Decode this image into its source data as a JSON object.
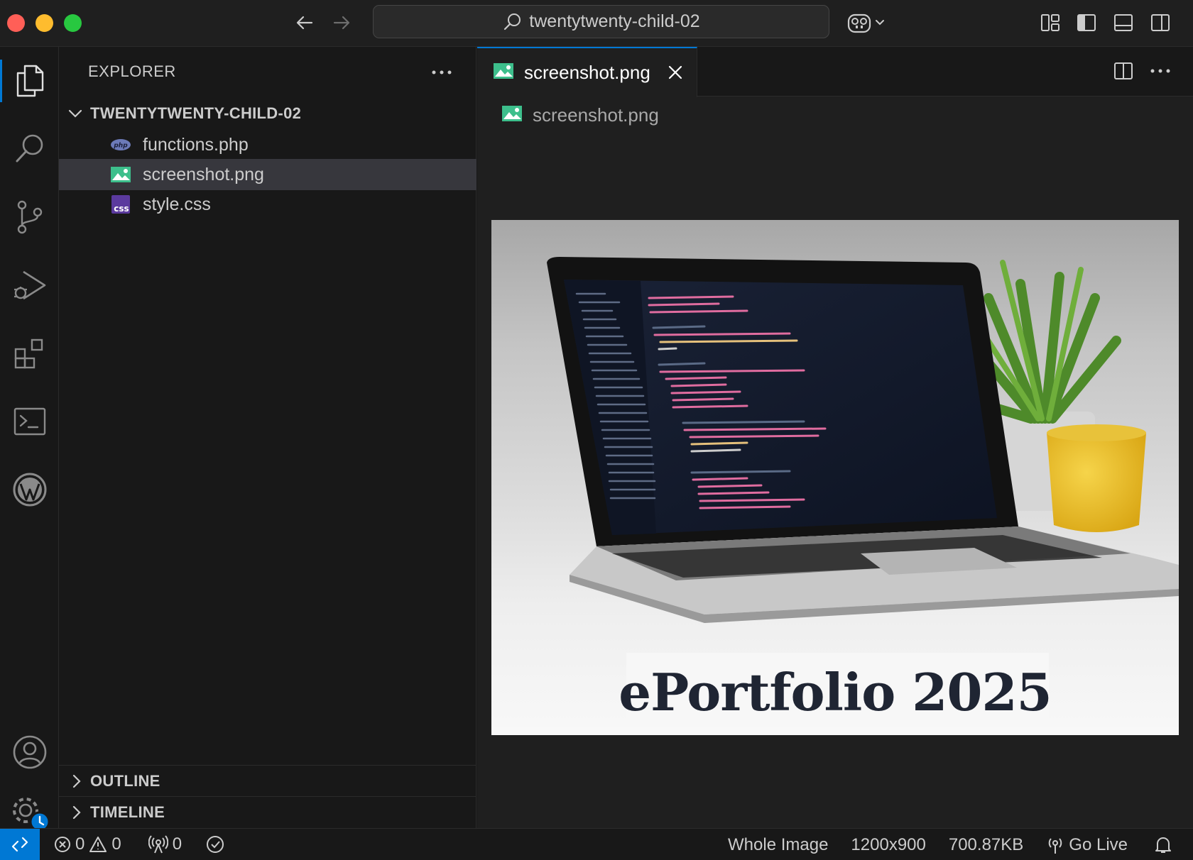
{
  "window": {
    "search_label": "twentytwenty-child-02"
  },
  "icons": {
    "back": "arrow-left-icon",
    "forward": "arrow-right-icon",
    "search": "search-icon",
    "copilot": "copilot-icon",
    "layout": "customize-layout-icon",
    "toggle_sidebar": "toggle-primary-sidebar-icon",
    "toggle_panel": "toggle-panel-icon",
    "toggle_secondary": "toggle-secondary-sidebar-icon"
  },
  "activity_bar": [
    {
      "name": "explorer",
      "icon": "files-icon",
      "active": true
    },
    {
      "name": "search",
      "icon": "search-icon"
    },
    {
      "name": "source-control",
      "icon": "source-control-icon"
    },
    {
      "name": "run-debug",
      "icon": "run-debug-icon"
    },
    {
      "name": "extensions",
      "icon": "extensions-icon"
    },
    {
      "name": "terminal",
      "icon": "terminal-icon"
    },
    {
      "name": "wordpress",
      "icon": "wordpress-icon"
    },
    {
      "name": "accounts",
      "icon": "account-icon"
    },
    {
      "name": "manage",
      "icon": "gear-icon"
    }
  ],
  "sidebar": {
    "title": "EXPLORER",
    "folder": "TWENTYTWENTY-CHILD-02",
    "files": [
      {
        "name": "functions.php",
        "icon": "php-file-icon",
        "selected": false
      },
      {
        "name": "screenshot.png",
        "icon": "image-file-icon",
        "selected": true
      },
      {
        "name": "style.css",
        "icon": "css-file-icon",
        "selected": false
      }
    ],
    "sections": {
      "outline": "OUTLINE",
      "timeline": "TIMELINE"
    }
  },
  "editor": {
    "tab_label": "screenshot.png",
    "breadcrumb": "screenshot.png",
    "image_caption": "ePortfolio 2025"
  },
  "status_bar": {
    "errors": "0",
    "warnings": "0",
    "ports": "0",
    "zoom_label": "Whole Image",
    "dimensions": "1200x900",
    "file_size": "700.87KB",
    "go_live": "Go Live"
  },
  "colors": {
    "accent": "#0078d4",
    "background": "#181818",
    "editor_background": "#1f1f1f",
    "selection": "#37373d"
  }
}
